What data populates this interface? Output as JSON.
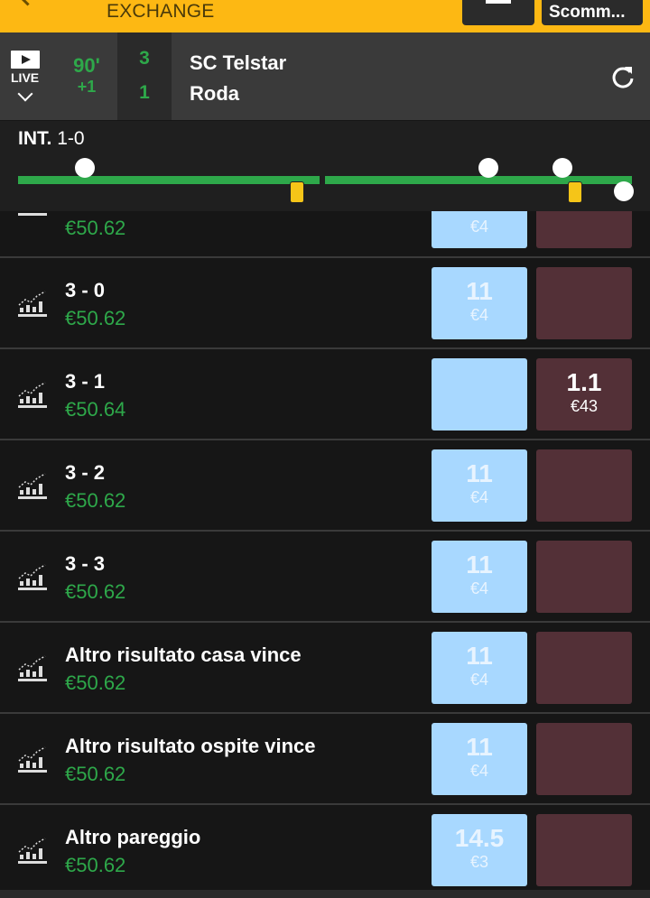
{
  "header": {
    "brand": "EXCHANGE",
    "bets_button": "Scomm..."
  },
  "match": {
    "live_label": "LIVE",
    "minute": "90'",
    "extra_time": "+1",
    "home_score": "3",
    "away_score": "1",
    "home_team": "SC Telstar",
    "away_team": "Roda"
  },
  "timeline": {
    "period": "INT.",
    "halftime_score": "1-0"
  },
  "rows": [
    {
      "name": "",
      "pl": "€50.62",
      "back_odds": "",
      "back_stake": "€4",
      "lay_odds": "",
      "lay_stake": ""
    },
    {
      "name": "3 - 0",
      "pl": "€50.62",
      "back_odds": "11",
      "back_stake": "€4",
      "lay_odds": "",
      "lay_stake": ""
    },
    {
      "name": "3 - 1",
      "pl": "€50.64",
      "back_odds": "",
      "back_stake": "",
      "lay_odds": "1.1",
      "lay_stake": "€43"
    },
    {
      "name": "3 - 2",
      "pl": "€50.62",
      "back_odds": "11",
      "back_stake": "€4",
      "lay_odds": "",
      "lay_stake": ""
    },
    {
      "name": "3 - 3",
      "pl": "€50.62",
      "back_odds": "11",
      "back_stake": "€4",
      "lay_odds": "",
      "lay_stake": ""
    },
    {
      "name": "Altro risultato casa vince",
      "pl": "€50.62",
      "back_odds": "11",
      "back_stake": "€4",
      "lay_odds": "",
      "lay_stake": ""
    },
    {
      "name": "Altro risultato ospite vince",
      "pl": "€50.62",
      "back_odds": "11",
      "back_stake": "€4",
      "lay_odds": "",
      "lay_stake": ""
    },
    {
      "name": "Altro pareggio",
      "pl": "€50.62",
      "back_odds": "14.5",
      "back_stake": "€3",
      "lay_odds": "",
      "lay_stake": ""
    }
  ],
  "colors": {
    "brand_yellow": "#fdb813",
    "profit_green": "#2ea84a",
    "back_blue": "#a8d8ff",
    "lay_maroon": "#533037"
  }
}
